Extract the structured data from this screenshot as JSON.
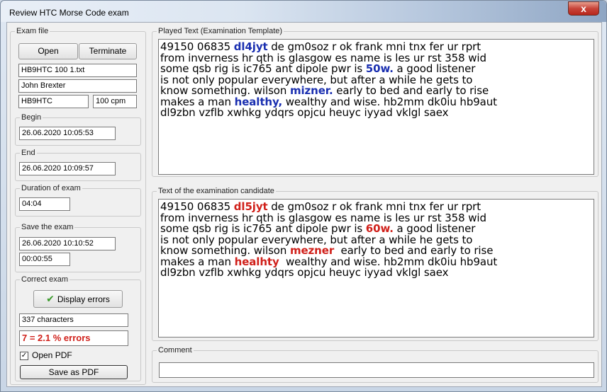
{
  "window": {
    "title": "Review HTC Morse Code exam",
    "close_glyph": "x"
  },
  "exam_file": {
    "legend": "Exam file",
    "open_label": "Open",
    "terminate_label": "Terminate",
    "file_name": "HB9HTC 100 1.txt",
    "operator_name": "John Brexter",
    "callsign": "HB9HTC",
    "speed": "100 cpm"
  },
  "begin": {
    "legend": "Begin",
    "value": "26.06.2020 10:05:53"
  },
  "end": {
    "legend": "End",
    "value": "26.06.2020 10:09:57"
  },
  "duration": {
    "legend": "Duration of exam",
    "value": "04:04"
  },
  "save_exam": {
    "legend": "Save the exam",
    "datetime": "26.06.2020 10:10:52",
    "elapsed": "00:00:55"
  },
  "correct_exam": {
    "legend": "Correct exam",
    "display_errors_label": "Display errors",
    "check_icon": "checkmark-icon",
    "characters": "337 characters",
    "errors": "7 = 2.1 % errors",
    "open_pdf_label": "Open PDF",
    "open_pdf_checked": true,
    "checkbox_glyph": "✓",
    "save_pdf_label": "Save as PDF"
  },
  "played_text": {
    "legend": "Played Text (Examination Template)",
    "lines": [
      [
        {
          "t": "49150 06835 "
        },
        {
          "t": "dl4jyt",
          "s": "blu"
        },
        {
          "t": " de gm0soz r ok frank mni tnx fer ur rprt"
        }
      ],
      [
        {
          "t": "from inverness hr qth is glasgow es name is les ur rst 358 wid"
        }
      ],
      [
        {
          "t": "some qsb rig is ic765 ant dipole pwr is "
        },
        {
          "t": "50w.",
          "s": "blu"
        },
        {
          "t": " a good listener"
        }
      ],
      [
        {
          "t": "is not only popular everywhere, but after a while he gets to"
        }
      ],
      [
        {
          "t": "know something. wilson "
        },
        {
          "t": "mizner.",
          "s": "blu"
        },
        {
          "t": " early to bed and early to rise"
        }
      ],
      [
        {
          "t": "makes a man "
        },
        {
          "t": "healthy,",
          "s": "blu"
        },
        {
          "t": " wealthy and wise. hb2mm dk0iu hb9aut"
        }
      ],
      [
        {
          "t": "dl9zbn vzflb xwhkg ydqrs opjcu heuyc iyyad vklgl saex"
        }
      ]
    ]
  },
  "candidate_text": {
    "legend": "Text of the examination candidate",
    "lines": [
      [
        {
          "t": "49150 06835 "
        },
        {
          "t": "dl5jyt",
          "s": "red"
        },
        {
          "t": " de gm0soz r ok frank mni tnx fer ur rprt"
        }
      ],
      [
        {
          "t": "from inverness hr qth is glasgow es name is les ur rst 358 wid"
        }
      ],
      [
        {
          "t": "some qsb rig is ic765 ant dipole pwr is "
        },
        {
          "t": "60w.",
          "s": "red"
        },
        {
          "t": " a good listener"
        }
      ],
      [
        {
          "t": "is not only popular everywhere, but after a while he gets to"
        }
      ],
      [
        {
          "t": "know something. wilson "
        },
        {
          "t": "mezner",
          "s": "red"
        },
        {
          "t": "  early to bed and early to rise"
        }
      ],
      [
        {
          "t": "makes a man "
        },
        {
          "t": "healhty",
          "s": "red"
        },
        {
          "t": "  wealthy and wise. hb2mm dk0iu hb9aut"
        }
      ],
      [
        {
          "t": "dl9zbn vzflb xwhkg ydqrs opjcu heuyc iyyad vklgl saex"
        }
      ]
    ]
  },
  "comment": {
    "legend": "Comment",
    "value": ""
  },
  "colors": {
    "error_red": "#d0201a",
    "template_blue": "#1a2fb0",
    "check_green": "#3a9a2a"
  }
}
